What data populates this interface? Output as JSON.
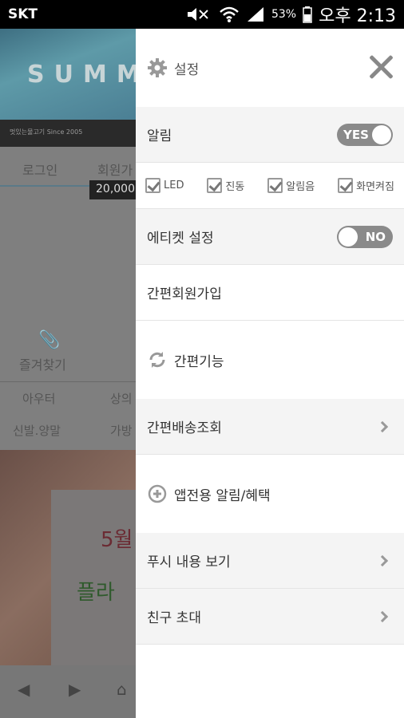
{
  "status_bar": {
    "carrier": "SKT",
    "battery": "53%",
    "time": "오후 2:13",
    "icons": [
      "mute-icon",
      "wifi-icon",
      "signal-icon",
      "battery-icon"
    ]
  },
  "background_app": {
    "banner_text": "SUMM",
    "banner_caption": "멋있는물고기 Since 2005",
    "login_label": "로그인",
    "join_label": "회원가",
    "tooltip": "20,000",
    "favorite_label": "즐겨찾기",
    "categories": [
      "아우터",
      "상의",
      "신발.양말",
      "가방"
    ],
    "promo_line1": "5월",
    "promo_line2": "플라"
  },
  "drawer": {
    "header": {
      "title": "설정",
      "icons": [
        "gear-icon",
        "close-icon"
      ]
    },
    "notification": {
      "label": "알림",
      "toggle": "YES"
    },
    "notification_options": [
      {
        "label": "LED",
        "checked": true
      },
      {
        "label": "진동",
        "checked": true
      },
      {
        "label": "알림음",
        "checked": true
      },
      {
        "label": "화면켜짐",
        "checked": true
      }
    ],
    "etiquette": {
      "label": "에티켓 설정",
      "toggle": "NO"
    },
    "quick_signup": {
      "label": "간편회원가입"
    },
    "quick_functions": {
      "label": "간편기능",
      "icon": "refresh-icon"
    },
    "delivery_lookup": {
      "label": "간편배송조회",
      "icon": "chevron-right-icon"
    },
    "app_benefits": {
      "label": "앱전용 알림/혜택",
      "icon": "plus-circle-icon"
    },
    "push_view": {
      "label": "푸시 내용 보기",
      "icon": "chevron-right-icon"
    },
    "invite_friend": {
      "label": "친구 초대",
      "icon": "chevron-right-icon"
    }
  },
  "colors": {
    "drawer_bg": "#ffffff",
    "row_gray": "#f4f4f4",
    "toggle_bg": "#8a8a8a",
    "overlay": "#777777"
  }
}
